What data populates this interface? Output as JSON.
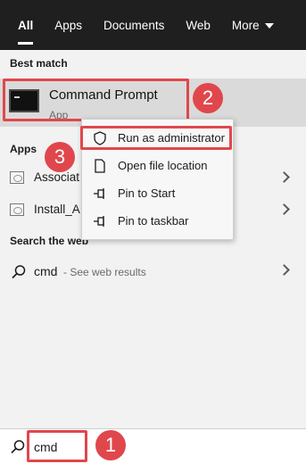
{
  "tabs": [
    {
      "label": "All",
      "active": true
    },
    {
      "label": "Apps"
    },
    {
      "label": "Documents"
    },
    {
      "label": "Web"
    },
    {
      "label": "More"
    }
  ],
  "best_match": {
    "heading": "Best match",
    "title": "Command Prompt",
    "subtitle": "App",
    "icon": "command-prompt-icon"
  },
  "apps": {
    "heading": "Apps",
    "items": [
      {
        "label": "Associat",
        "icon": "app-icon"
      },
      {
        "label": "Install_A",
        "icon": "app-icon"
      }
    ]
  },
  "web": {
    "heading": "Search the web",
    "query": "cmd",
    "hint": "- See web results"
  },
  "context_menu": {
    "items": [
      {
        "label": "Run as administrator",
        "icon": "shield-icon"
      },
      {
        "label": "Open file location",
        "icon": "file-icon"
      },
      {
        "label": "Pin to Start",
        "icon": "pin-icon"
      },
      {
        "label": "Pin to taskbar",
        "icon": "pin-icon"
      }
    ]
  },
  "search": {
    "value": "cmd",
    "icon": "search-icon"
  },
  "annotations": {
    "badge_1": "1",
    "badge_2": "2",
    "badge_3": "3",
    "accent_color": "#e0474c"
  }
}
